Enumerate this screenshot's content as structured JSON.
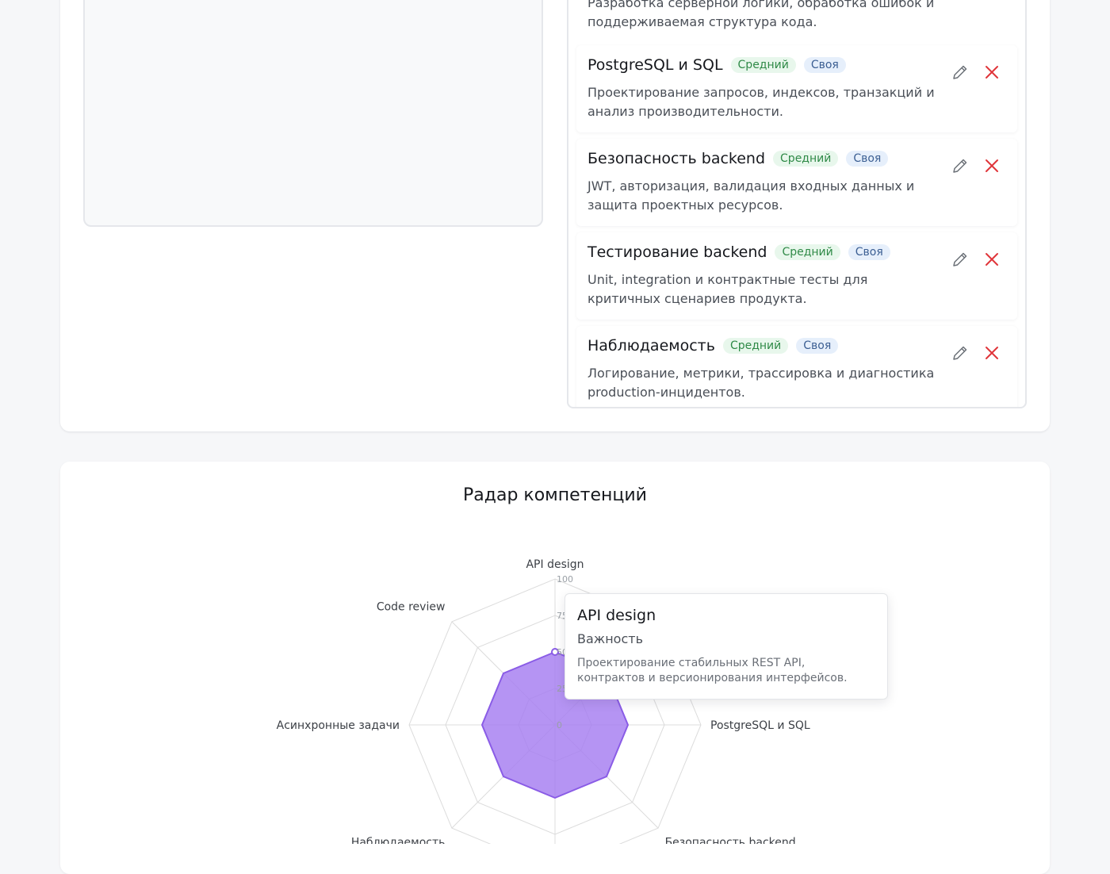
{
  "skills_list": {
    "first_item_desc": "Разработка серверной логики, обработка ошибок и поддерживаемая структура кода.",
    "items": [
      {
        "title": "PostgreSQL и SQL",
        "level": "Средний",
        "owner": "Своя",
        "description": "Проектирование запросов, индексов, транзакций и анализ производительности."
      },
      {
        "title": "Безопасность backend",
        "level": "Средний",
        "owner": "Своя",
        "description": "JWT, авторизация, валидация входных данных и защита проектных ресурсов."
      },
      {
        "title": "Тестирование backend",
        "level": "Средний",
        "owner": "Своя",
        "description": "Unit, integration и контрактные тесты для критичных сценариев продукта."
      },
      {
        "title": "Наблюдаемость",
        "level": "Средний",
        "owner": "Своя",
        "description": "Логирование, метрики, трассировка и диагностика production-инцидентов."
      }
    ],
    "icons": {
      "edit": "pencil-icon",
      "delete": "close-icon"
    }
  },
  "radar": {
    "title": "Радар компетенций",
    "tooltip": {
      "title": "API design",
      "subtitle": "Важность",
      "description": "Проектирование стабильных REST API, контрактов и версионирования интерфейсов."
    }
  },
  "chart_data": {
    "type": "radar",
    "title": "Радар компетенций",
    "axes": [
      "API design",
      "",
      "PostgreSQL и SQL",
      "Безопасность backend",
      "",
      "Наблюдаемость",
      "Асинхронные задачи",
      "Code review"
    ],
    "ticks": [
      "0",
      "25",
      "50",
      "75",
      "100"
    ],
    "range": [
      0,
      100
    ],
    "series": [
      {
        "name": "Важность",
        "values": [
          50,
          50,
          50,
          50,
          50,
          50,
          50,
          50
        ]
      }
    ],
    "colors": {
      "fill": "#a57cf0",
      "stroke": "#8a5ce6",
      "grid": "#dcdcdc"
    }
  }
}
